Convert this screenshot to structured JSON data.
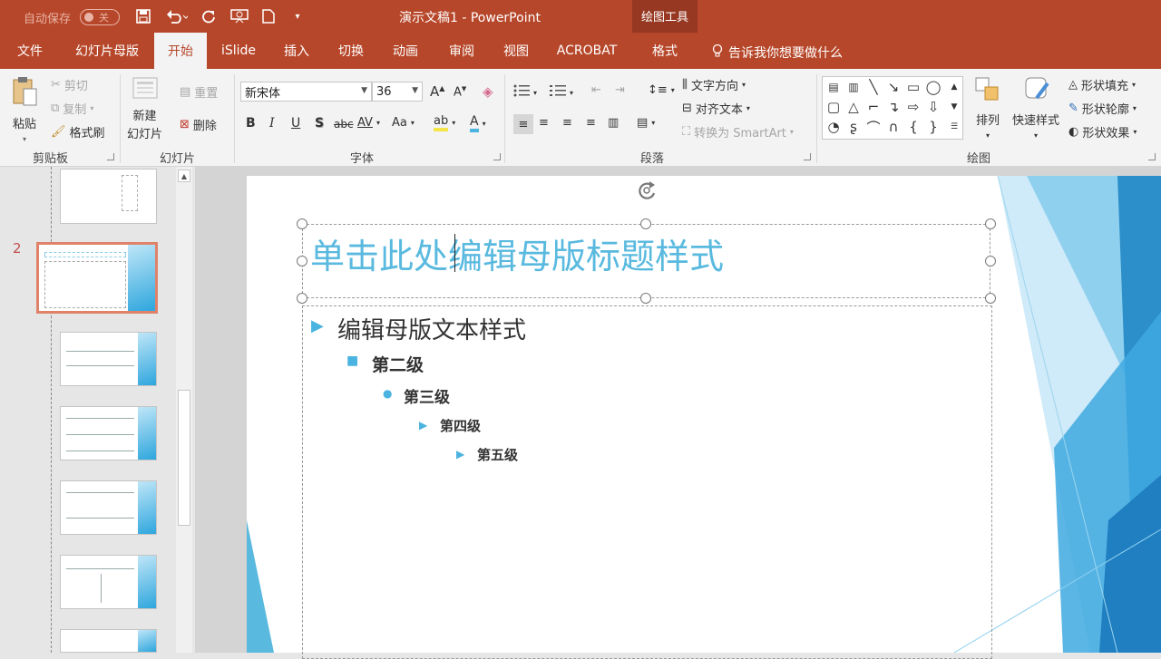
{
  "titlebar": {
    "autosave_label": "自动保存",
    "autosave_state": "关",
    "doc_title": "演示文稿1  -  PowerPoint",
    "contextual_group": "绘图工具"
  },
  "tabs": [
    "文件",
    "幻灯片母版",
    "开始",
    "iSlide",
    "插入",
    "切换",
    "动画",
    "审阅",
    "视图",
    "ACROBAT",
    "格式"
  ],
  "active_tab": "开始",
  "tell_me": "告诉我你想要做什么",
  "ribbon": {
    "clipboard": {
      "paste": "粘贴",
      "cut": "剪切",
      "copy": "复制",
      "format_painter": "格式刷",
      "label": "剪贴板"
    },
    "slides": {
      "new_slide": "新建",
      "new_slide2": "幻灯片",
      "reset": "重置",
      "delete": "删除",
      "label": "幻灯片"
    },
    "font": {
      "name": "新宋体",
      "size": "36",
      "bold": "B",
      "italic": "I",
      "underline": "U",
      "shadow": "S",
      "strike": "abc",
      "spacing": "AV",
      "case": "Aa",
      "label": "字体"
    },
    "paragraph": {
      "text_direction": "文字方向",
      "align_text": "对齐文本",
      "smartart": "转换为 SmartArt",
      "label": "段落"
    },
    "drawing": {
      "arrange": "排列",
      "quick_styles": "快速样式",
      "shape_fill": "形状填充",
      "shape_outline": "形状轮廓",
      "shape_effects": "形状效果",
      "label": "绘图"
    }
  },
  "slide_pane": {
    "selected_number": "2"
  },
  "slide": {
    "title": "单击此处编辑母版标题样式",
    "level1": "编辑母版文本样式",
    "level2": "第二级",
    "level3": "第三级",
    "level4": "第四级",
    "level5": "第五级"
  },
  "colors": {
    "accent": "#b7472a",
    "title_text": "#59b9df",
    "bullet": "#4bb3df"
  }
}
